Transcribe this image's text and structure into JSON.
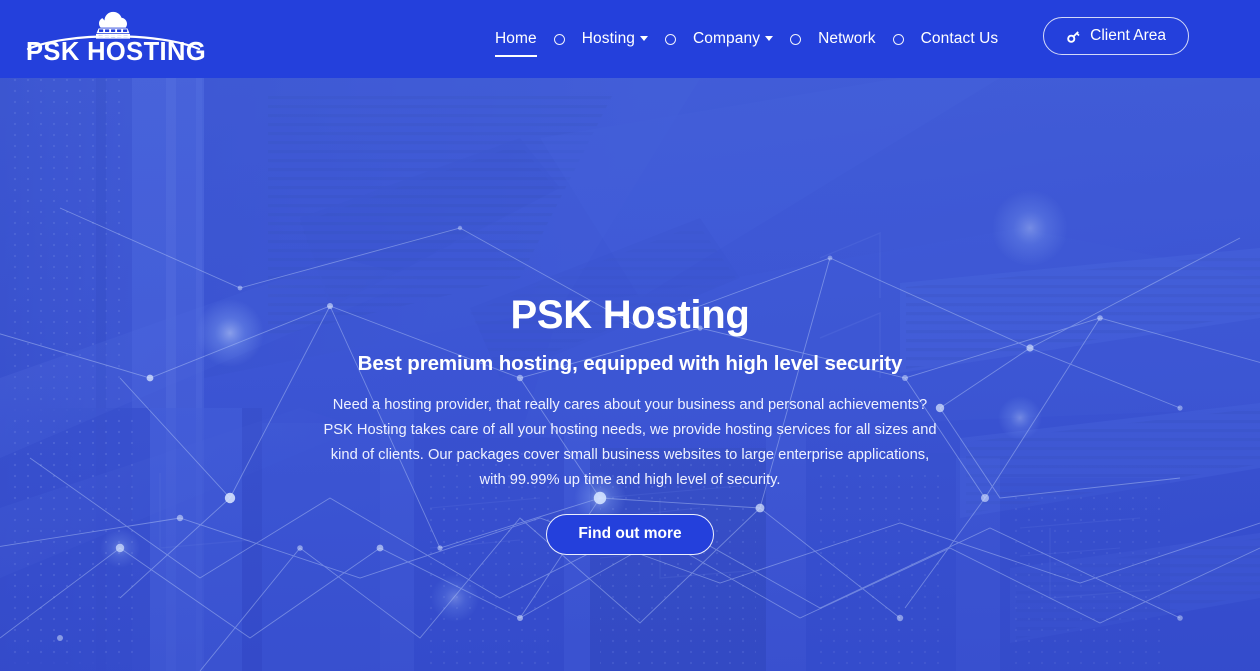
{
  "brand": {
    "name": "PSK HOSTING",
    "logo_icon": "cloud-server-icon"
  },
  "nav": {
    "items": [
      {
        "label": "Home",
        "active": true,
        "has_dropdown": false
      },
      {
        "label": "Hosting",
        "active": false,
        "has_dropdown": true
      },
      {
        "label": "Company",
        "active": false,
        "has_dropdown": true
      },
      {
        "label": "Network",
        "active": false,
        "has_dropdown": false
      },
      {
        "label": "Contact Us",
        "active": false,
        "has_dropdown": false
      }
    ],
    "separator_icon": "circle-outline-icon"
  },
  "client_area": {
    "label": "Client Area",
    "icon": "key-icon"
  },
  "hero": {
    "title": "PSK Hosting",
    "subtitle": "Best premium hosting, equipped with high level security",
    "paragraph": "Need a hosting provider, that really cares about your business and personal achievements? PSK Hosting takes care of all your hosting needs, we provide hosting services for all sizes and kind of clients. Our packages cover small business websites to large enterprise applications, with 99.99% up time and high level of security.",
    "cta_label": "Find out more",
    "background": "data-center-server-racks-with-network-overlay"
  },
  "colors": {
    "header_blue": "#2440dc",
    "hero_blue": "#4155d6",
    "accent_blue": "#2440dc",
    "text_white": "#ffffff"
  }
}
